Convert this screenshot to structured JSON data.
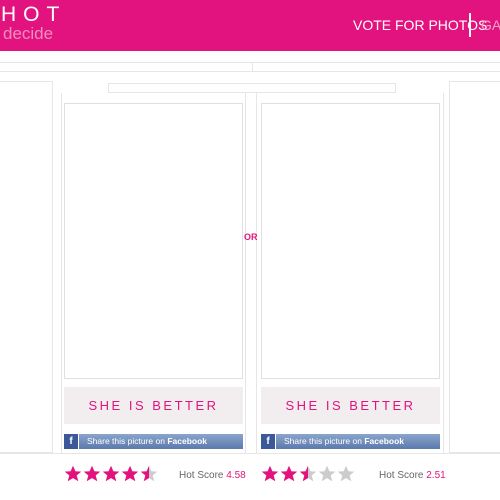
{
  "colors": {
    "brand": "#e2137e",
    "star_on": "#e2137e",
    "star_off": "#cccccc"
  },
  "logo": {
    "top": "HOT",
    "bottom": "decide"
  },
  "nav": {
    "vote": "VOTE FOR PHOTOS",
    "gallery_partial": "GAL"
  },
  "compare": {
    "or": "OR",
    "left": {
      "button": "SHE IS BETTER",
      "share_prefix": "Share this picture on",
      "share_brand": "Facebook",
      "hot_label": "Hot Score",
      "hot_score": "4.58",
      "stars": [
        1,
        1,
        1,
        1,
        0.5
      ]
    },
    "right": {
      "button": "SHE IS BETTER",
      "share_prefix": "Share this picture on",
      "share_brand": "Facebook",
      "hot_label": "Hot Score",
      "hot_score": "2.51",
      "stars": [
        1,
        1,
        0.5,
        0,
        0
      ]
    }
  },
  "icons": {
    "facebook": "facebook-icon",
    "star": "star-icon"
  }
}
